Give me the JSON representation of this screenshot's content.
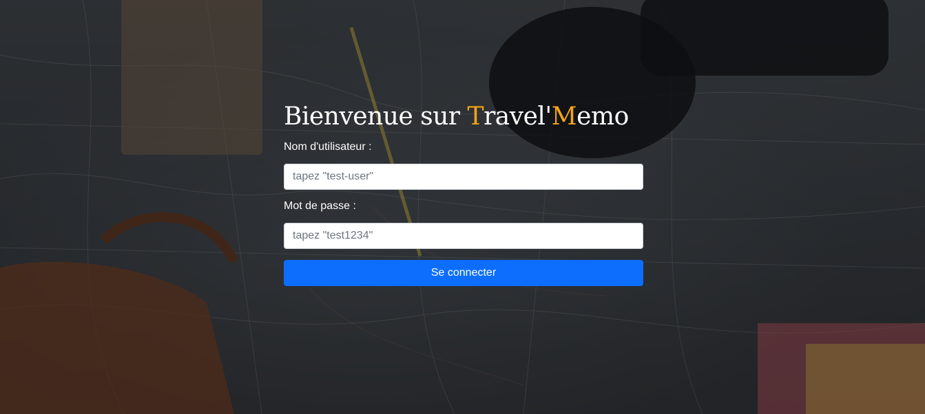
{
  "heading": {
    "part1": "Bienvenue sur ",
    "accent_T": "T",
    "part2": "ravel'",
    "accent_M": "M",
    "part3": "emo"
  },
  "form": {
    "username_label": "Nom d'utilisateur :",
    "username_placeholder": "tapez \"test-user\"",
    "password_label": "Mot de passe :",
    "password_placeholder": "tapez \"test1234\"",
    "submit_label": "Se connecter"
  },
  "colors": {
    "accent": "#f5a418",
    "primary_button": "#0d6efd",
    "text": "#ffffff"
  }
}
